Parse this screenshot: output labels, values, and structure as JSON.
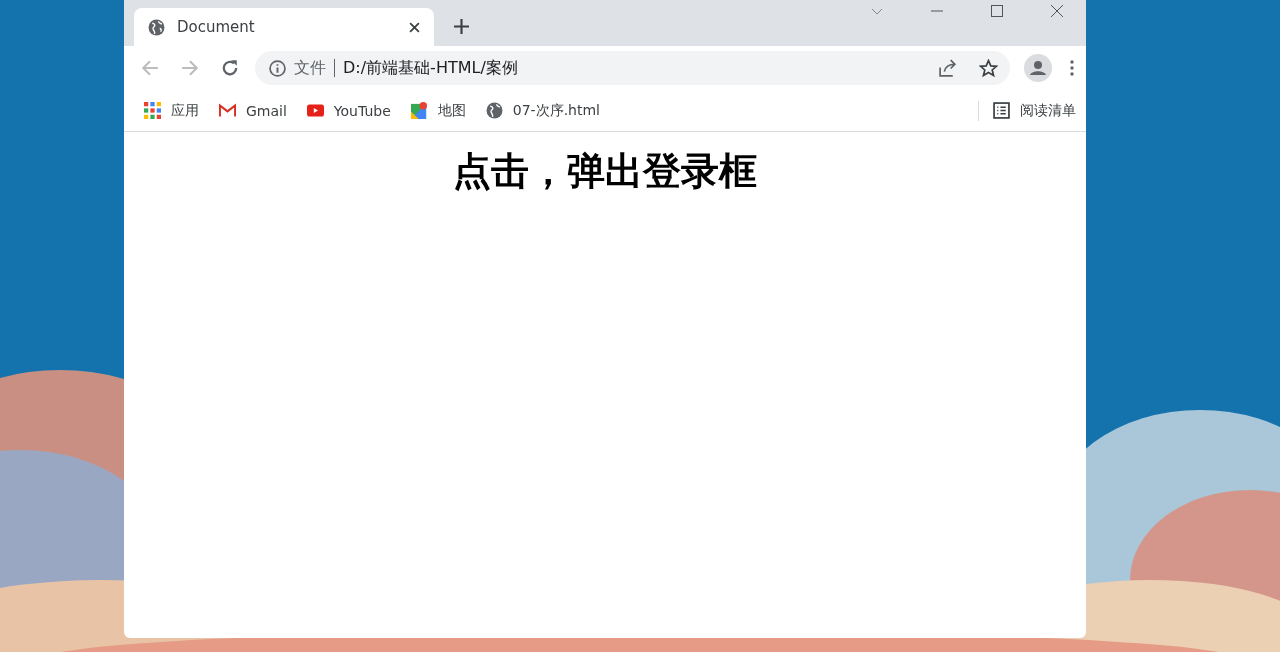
{
  "tabs": [
    {
      "title": "Document",
      "selected": true
    }
  ],
  "address_bar": {
    "security_label": "文件",
    "url": "D:/前端基础-HTML/案例"
  },
  "bookmarks": [
    {
      "label": "应用",
      "kind": "apps"
    },
    {
      "label": "Gmail",
      "kind": "gmail"
    },
    {
      "label": "YouTube",
      "kind": "youtube"
    },
    {
      "label": "地图",
      "kind": "maps"
    },
    {
      "label": "07-次序.html",
      "kind": "globe"
    }
  ],
  "reading_list": {
    "label": "阅读清单"
  },
  "page": {
    "heading": "点击，弹出登录框"
  }
}
